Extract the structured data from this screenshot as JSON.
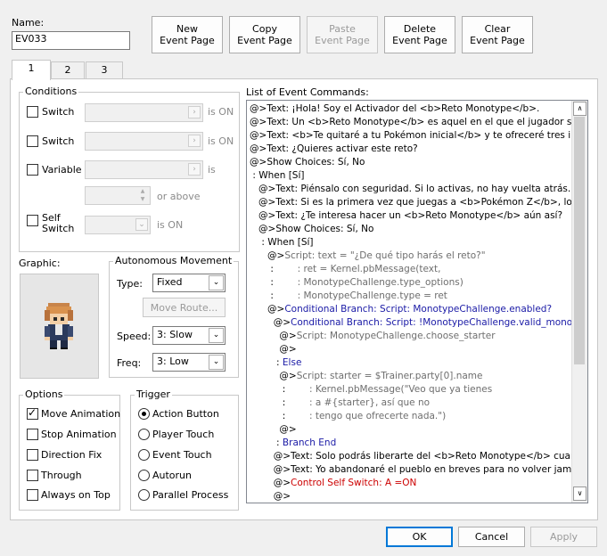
{
  "name": {
    "label": "Name:",
    "value": "EV033"
  },
  "top_buttons": [
    {
      "line1": "New",
      "line2": "Event Page",
      "enabled": true
    },
    {
      "line1": "Copy",
      "line2": "Event Page",
      "enabled": true
    },
    {
      "line1": "Paste",
      "line2": "Event Page",
      "enabled": false
    },
    {
      "line1": "Delete",
      "line2": "Event Page",
      "enabled": true
    },
    {
      "line1": "Clear",
      "line2": "Event Page",
      "enabled": true
    }
  ],
  "tabs": [
    "1",
    "2",
    "3"
  ],
  "conditions": {
    "title": "Conditions",
    "switch1": {
      "label": "Switch",
      "suffix": "is ON"
    },
    "switch2": {
      "label": "Switch",
      "suffix": "is ON"
    },
    "variable": {
      "label": "Variable",
      "suffix": "is",
      "or_above": "or above"
    },
    "self_switch": {
      "label_line1": "Self",
      "label_line2": "Switch",
      "suffix": "is ON"
    }
  },
  "graphic": {
    "label": "Graphic:"
  },
  "autonomous": {
    "title": "Autonomous Movement",
    "type_label": "Type:",
    "type_value": "Fixed",
    "move_route": "Move Route...",
    "speed_label": "Speed:",
    "speed_value": "3: Slow",
    "freq_label": "Freq:",
    "freq_value": "3: Low"
  },
  "options": {
    "title": "Options",
    "items": [
      {
        "label": "Move Animation",
        "checked": true
      },
      {
        "label": "Stop Animation",
        "checked": false
      },
      {
        "label": "Direction Fix",
        "checked": false
      },
      {
        "label": "Through",
        "checked": false
      },
      {
        "label": "Always on Top",
        "checked": false
      }
    ]
  },
  "trigger": {
    "title": "Trigger",
    "items": [
      {
        "label": "Action Button",
        "checked": true
      },
      {
        "label": "Player Touch",
        "checked": false
      },
      {
        "label": "Event Touch",
        "checked": false
      },
      {
        "label": "Autorun",
        "checked": false
      },
      {
        "label": "Parallel Process",
        "checked": false
      }
    ]
  },
  "commands": {
    "label": "List of Event Commands:",
    "lines": [
      [
        "@>",
        "Text: ¡Hola! Soy el Activador del <b>Reto Monotype</b>.",
        "p"
      ],
      [
        "@>",
        "Text: Un <b>Reto Monotype</b> es aquel en el que el jugador solo pu",
        "p"
      ],
      [
        "@>",
        "Text: <b>Te quitaré a tu Pokémon inicial</b> y te ofreceré tres iniciale",
        "p"
      ],
      [
        "@>",
        "Text: ¿Quieres activar este reto?",
        "p"
      ],
      [
        "@>",
        "Show Choices: Sí, No",
        "p"
      ],
      [
        " : ",
        "When [Sí]",
        "p"
      ],
      [
        "   @>",
        "Text: Piénsalo con seguridad. Si lo activas, no hay vuelta atrás.",
        "p"
      ],
      [
        "   @>",
        "Text: Si es la primera vez que juegas a <b>Pokémon Z</b>, lo más s",
        "p"
      ],
      [
        "   @>",
        "Text: ¿Te interesa hacer un <b>Reto Monotype</b> aún así?",
        "p"
      ],
      [
        "   @>",
        "Show Choices: Sí, No",
        "p"
      ],
      [
        "    : ",
        "When [Sí]",
        "p"
      ],
      [
        "      @>",
        "Script: text = \"¿De qué tipo harás el reto?\"",
        "g"
      ],
      [
        "       :        ",
        ": ret = Kernel.pbMessage(text,",
        "g"
      ],
      [
        "       :        ",
        ": MonotypeChallenge.type_options)",
        "g"
      ],
      [
        "       :        ",
        ": MonotypeChallenge.type = ret",
        "g"
      ],
      [
        "      @>",
        "Conditional Branch: Script: MonotypeChallenge.enabled?",
        "b"
      ],
      [
        "        @>",
        "Conditional Branch: Script: !MonotypeChallenge.valid_monotype",
        "b"
      ],
      [
        "          @>",
        "Script: MonotypeChallenge.choose_starter",
        "g"
      ],
      [
        "          @>",
        "",
        "p"
      ],
      [
        "         : ",
        "Else",
        "b"
      ],
      [
        "          @>",
        "Script: starter = $Trainer.party[0].name",
        "g"
      ],
      [
        "           :        ",
        ": Kernel.pbMessage(\"Veo que ya tienes",
        "g"
      ],
      [
        "           :        ",
        ": a #{starter}, así que no",
        "g"
      ],
      [
        "           :        ",
        ": tengo que ofrecerte nada.\")",
        "g"
      ],
      [
        "          @>",
        "",
        "p"
      ],
      [
        "         : ",
        "Branch End",
        "b"
      ],
      [
        "        @>",
        "Text: Solo podrás liberarte del <b>Reto Monotype</b> cuando",
        "p"
      ],
      [
        "        @>",
        "Text: Yo abandonaré el pueblo en breves para no volver jamás,",
        "p"
      ],
      [
        "        @>",
        "Control Self Switch: A =ON",
        "r"
      ],
      [
        "        @>",
        "",
        "p"
      ]
    ]
  },
  "footer": {
    "ok": "OK",
    "cancel": "Cancel",
    "apply": "Apply"
  }
}
